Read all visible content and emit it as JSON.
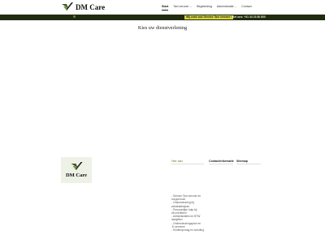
{
  "header": {
    "brand": "DM Care",
    "nav": [
      {
        "label": "Start",
        "active": true,
        "chevron": false
      },
      {
        "label": "Taxi vervoer",
        "active": false,
        "chevron": true
      },
      {
        "label": "Begeleiding",
        "active": false,
        "chevron": false
      },
      {
        "label": "Administratie",
        "active": false,
        "chevron": true
      },
      {
        "label": "Contact",
        "active": false,
        "chevron": false
      }
    ],
    "chevron_glyph": "⌄"
  },
  "topbar": {
    "highlight": "Wij zoek ook Service Taxi vervoer !",
    "phone": "Bel ons: +31 43 23 80 800"
  },
  "main": {
    "title": "Kies uw dienstverlening"
  },
  "footer": {
    "brand": "DM Care",
    "col1_title": "Hier aan",
    "col2_title": "Contactinformatie",
    "col3_title": "Sitemap",
    "services": [
      "- Service Taxi vervoer en",
      "zorgvervoer",
      "- Ondersteuning bij",
      "ziekteafdwijzen",
      "- Persoonlijke hulp bij",
      "dit overleken",
      "- Administraties en BTW",
      "aangiften",
      "- Ondersteuningsplan en",
      "-E-services",
      "- Kinderopvang en scholing"
    ]
  },
  "colors": {
    "topbar_bg": "#1f2c0f",
    "highlight": "#d8d43a",
    "brand_green": "#4a7b2c"
  },
  "icons": {
    "logo": "dm-care-checkmark-logo"
  }
}
